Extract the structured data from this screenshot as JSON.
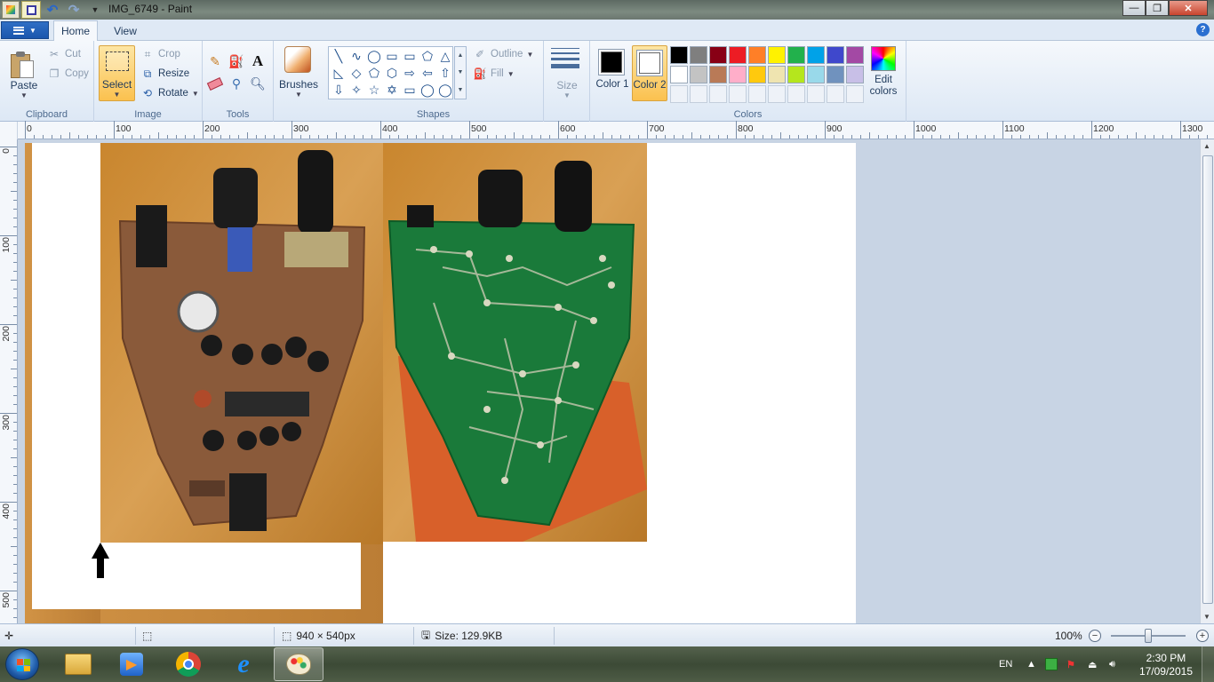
{
  "window": {
    "title": "IMG_6749 - Paint",
    "minimize": "—",
    "maximize": "❐",
    "close": "✕"
  },
  "tabs": {
    "home": "Home",
    "view": "View",
    "help": "?"
  },
  "clipboard": {
    "paste": "Paste",
    "cut": "Cut",
    "copy": "Copy",
    "group": "Clipboard"
  },
  "image": {
    "select": "Select",
    "crop": "Crop",
    "resize": "Resize",
    "rotate": "Rotate",
    "group": "Image"
  },
  "tools": {
    "group": "Tools",
    "text_icon": "A"
  },
  "brushes": {
    "label": "Brushes"
  },
  "shapes": {
    "outline": "Outline",
    "fill": "Fill",
    "group": "Shapes",
    "items": [
      "╲",
      "∿",
      "◯",
      "▭",
      "▭",
      "⬠",
      "△",
      "◺",
      "◇",
      "⬠",
      "⬡",
      "⇨",
      "⇦",
      "⇧",
      "⇩",
      "✧",
      "☆",
      "✡",
      "▭",
      "◯",
      "◯"
    ]
  },
  "size": {
    "label": "Size"
  },
  "colors": {
    "color1_label": "Color 1",
    "color2_label": "Color 2",
    "color1": "#000000",
    "color2": "#ffffff",
    "edit": "Edit colors",
    "group": "Colors",
    "palette": [
      "#000000",
      "#7f7f7f",
      "#880015",
      "#ed1c24",
      "#ff7f27",
      "#fff200",
      "#22b14c",
      "#00a2e8",
      "#3f48cc",
      "#a349a4",
      "#ffffff",
      "#c3c3c3",
      "#b97a57",
      "#ffaec9",
      "#ffc90e",
      "#efe4b0",
      "#b5e61d",
      "#99d9ea",
      "#7092be",
      "#c8bfe7"
    ]
  },
  "rulers": {
    "h": [
      "0",
      "100",
      "200",
      "300",
      "400",
      "500",
      "600",
      "700",
      "800",
      "900",
      "1000",
      "1100",
      "1200",
      "1300"
    ],
    "v": [
      "0",
      "100",
      "200",
      "300",
      "400",
      "500"
    ]
  },
  "status": {
    "dimensions": "940 × 540px",
    "size": "Size: 129.9KB",
    "zoom": "100%",
    "zoom_level": 0.5
  },
  "taskbar": {
    "language": "EN",
    "time": "2:30 PM",
    "date": "17/09/2015"
  }
}
